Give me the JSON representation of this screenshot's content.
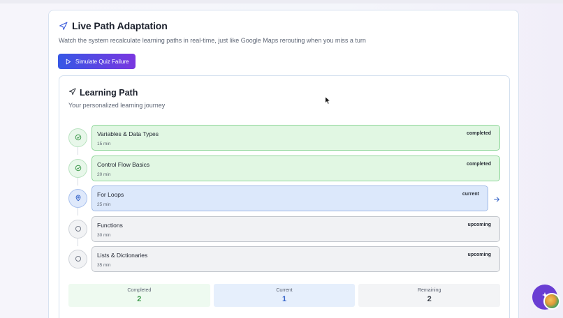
{
  "header": {
    "title": "Live Path Adaptation",
    "description": "Watch the system recalculate learning paths in real-time, just like Google Maps rerouting when you miss a turn",
    "simulate_button": "Simulate Quiz Failure"
  },
  "learning_path": {
    "title": "Learning Path",
    "subtitle": "Your personalized learning journey",
    "steps": [
      {
        "name": "Variables & Data Types",
        "duration": "15 min",
        "status": "completed"
      },
      {
        "name": "Control Flow Basics",
        "duration": "20 min",
        "status": "completed"
      },
      {
        "name": "For Loops",
        "duration": "25 min",
        "status": "current"
      },
      {
        "name": "Functions",
        "duration": "30 min",
        "status": "upcoming"
      },
      {
        "name": "Lists & Dictionaries",
        "duration": "35 min",
        "status": "upcoming"
      }
    ],
    "stats": {
      "completed_label": "Completed",
      "completed_value": "2",
      "current_label": "Current",
      "current_value": "1",
      "remaining_label": "Remaining",
      "remaining_value": "2"
    }
  },
  "icons": {
    "title_icon": "navigation-arrow-icon",
    "button_icon": "play-icon",
    "completed_icon": "check-circle-icon",
    "current_icon": "map-pin-icon",
    "upcoming_icon": "circle-icon",
    "next_icon": "arrow-right-icon"
  },
  "colors": {
    "accent_start": "#3657e5",
    "accent_end": "#7a36e0",
    "completed_green": "#8fd69a",
    "current_blue": "#9fb9e6"
  }
}
